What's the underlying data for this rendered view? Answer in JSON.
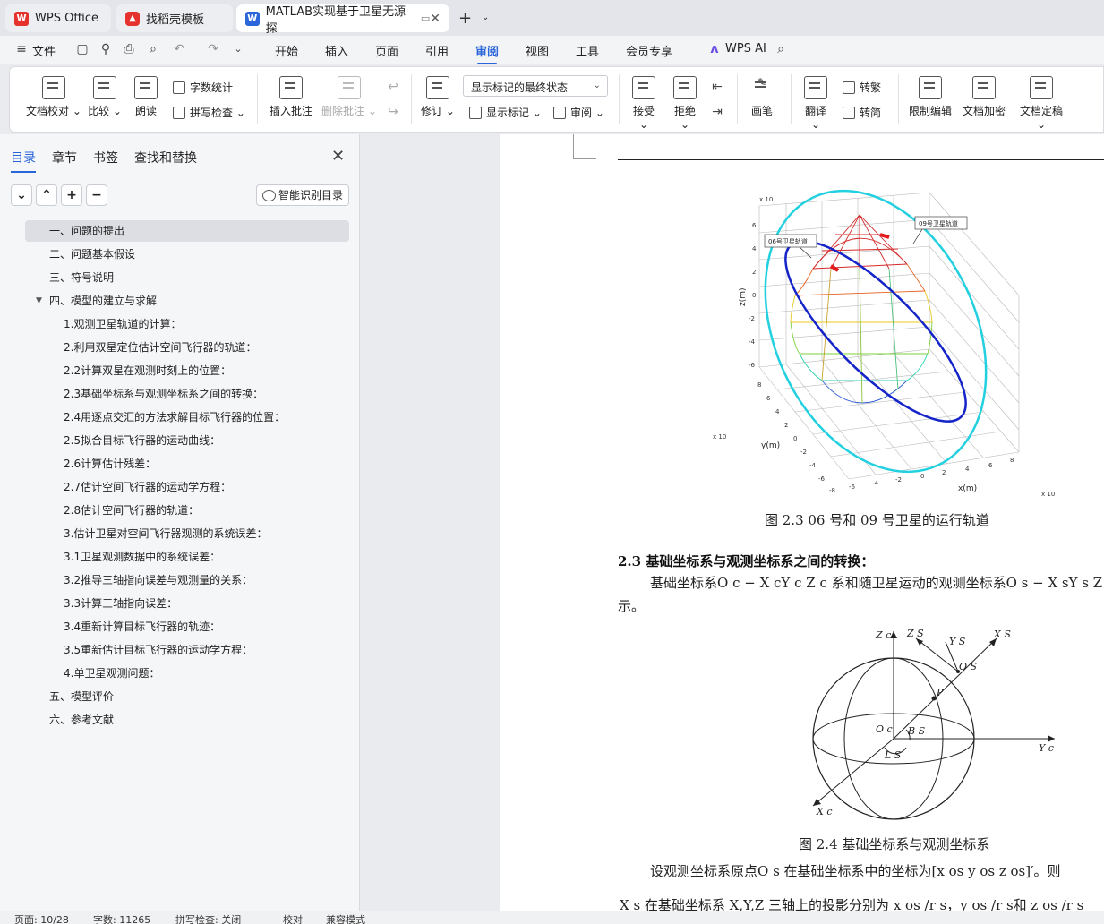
{
  "tabs": [
    {
      "label": "WPS Office"
    },
    {
      "label": "找稻壳模板"
    },
    {
      "label": "MATLAB实现基于卫星无源探"
    }
  ],
  "menu": {
    "file": "文件",
    "items": [
      "开始",
      "插入",
      "页面",
      "引用",
      "审阅",
      "视图",
      "工具",
      "会员专享"
    ],
    "active": "审阅",
    "wps_ai": "WPS AI"
  },
  "ribbon": {
    "proofread": "文档校对",
    "compare": "比较",
    "read_aloud": "朗读",
    "word_count": "字数统计",
    "spell_check": "拼写检查",
    "insert_comment": "插入批注",
    "delete_comment": "删除批注",
    "revise": "修订",
    "markup_state": "显示标记的最终状态",
    "show_markup": "显示标记",
    "review": "审阅",
    "accept": "接受",
    "reject": "拒绝",
    "pen": "画笔",
    "translate": "翻译",
    "to_traditional": "转繁",
    "to_simplified": "转简",
    "restrict_edit": "限制编辑",
    "encrypt": "文档加密",
    "finalize": "文档定稿"
  },
  "panel": {
    "tabs": [
      "目录",
      "章节",
      "书签",
      "查找和替换"
    ],
    "smart_toc": "智能识别目录",
    "toc": [
      {
        "label": "一、问题的提出",
        "level": 0,
        "selected": true
      },
      {
        "label": "二、问题基本假设",
        "level": 0
      },
      {
        "label": "三、符号说明",
        "level": 0
      },
      {
        "label": "四、模型的建立与求解",
        "level": 0,
        "expanded": true
      },
      {
        "label": "1.观测卫星轨道的计算：",
        "level": 1
      },
      {
        "label": "2.利用双星定位估计空间飞行器的轨道：",
        "level": 1
      },
      {
        "label": "2.2计算双星在观测时刻上的位置：",
        "level": 1
      },
      {
        "label": "2.3基础坐标系与观测坐标系之间的转换：",
        "level": 1
      },
      {
        "label": "2.4用逐点交汇的方法求解目标飞行器的位置：",
        "level": 1
      },
      {
        "label": "2.5拟合目标飞行器的运动曲线：",
        "level": 1
      },
      {
        "label": "2.6计算估计残差：",
        "level": 1
      },
      {
        "label": "2.7估计空间飞行器的运动学方程：",
        "level": 1
      },
      {
        "label": "2.8估计空间飞行器的轨道：",
        "level": 1
      },
      {
        "label": "3.估计卫星对空间飞行器观测的系统误差：",
        "level": 1
      },
      {
        "label": "3.1卫星观测数据中的系统误差：",
        "level": 1
      },
      {
        "label": "3.2推导三轴指向误差与观测量的关系：",
        "level": 1
      },
      {
        "label": "3.3计算三轴指向误差：",
        "level": 1
      },
      {
        "label": "3.4重新计算目标飞行器的轨迹：",
        "level": 1
      },
      {
        "label": "3.5重新估计目标飞行器的运动学方程：",
        "level": 1
      },
      {
        "label": "4.单卫星观测问题：",
        "level": 1
      },
      {
        "label": "五、模型评价",
        "level": 0
      },
      {
        "label": "六、参考文献",
        "level": 0
      }
    ]
  },
  "document": {
    "figure1": {
      "zlabel": "z(m)",
      "ylabel": "y(m)",
      "xlabel": "x(m)",
      "scale": "x 10",
      "label06": "06号卫星轨道",
      "label09": "09号卫星轨道",
      "caption": "图 2.3 06 号和 09 号卫星的运行轨道"
    },
    "heading": "2.3  基础坐标系与观测坐标系之间的转换：",
    "para1_line1": "基础坐标系O c − X cY c Z c 系和随卫星运动的观测坐标系O s − X sY s Z s 如下",
    "para1_line2": "示。",
    "figure2": {
      "labels": [
        "Z c",
        "Z S",
        "Y S",
        "X S",
        "O S",
        "P",
        "O c",
        "B S",
        "Y c",
        "L S",
        "X c"
      ],
      "caption": "图 2.4 基础坐标系与观测坐标系"
    },
    "para2_line1": "设观测坐标系原点O s 在基础坐标系中的坐标为[x os  y os  z os]′。则",
    "para2_line2": "X s 在基础坐标系 X,Y,Z 三轴上的投影分别为 x os /r s，y os /r s和 z os /r s"
  },
  "status": {
    "page": "页面: 10/28",
    "words": "字数: 11265",
    "spell": "拼写检查: 关闭",
    "proof": "校对",
    "compat": "兼容模式"
  }
}
